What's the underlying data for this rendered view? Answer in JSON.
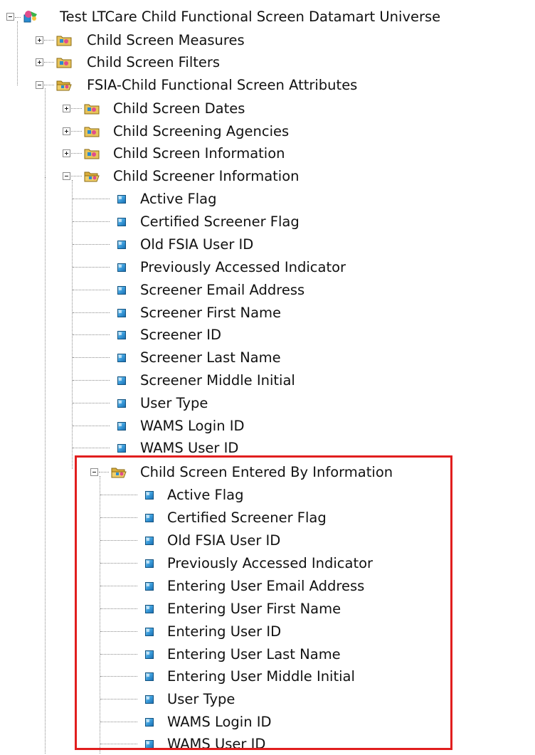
{
  "colors": {
    "highlight": "#e11e1e",
    "field_icon": "#2a8bd0",
    "folder": "#e7c35a"
  },
  "root": {
    "label": "Test LTCare Child Functional Screen Datamart Universe",
    "icon": "universe-icon",
    "expanded": true
  },
  "level1": [
    {
      "label": "Child Screen Measures",
      "icon": "class-folder-icon",
      "expanded": false
    },
    {
      "label": "Child Screen Filters",
      "icon": "class-folder-icon",
      "expanded": false
    },
    {
      "label": "FSIA-Child Functional Screen Attributes",
      "icon": "class-folder-open-icon",
      "expanded": true
    }
  ],
  "level2": [
    {
      "label": "Child Screen Dates",
      "expanded": false
    },
    {
      "label": "Child Screening Agencies",
      "expanded": false
    },
    {
      "label": "Child Screen Information",
      "expanded": false
    },
    {
      "label": "Child Screener Information",
      "expanded": true
    }
  ],
  "screener_fields": [
    "Active Flag",
    "Certified Screener Flag",
    "Old FSIA User ID",
    "Previously Accessed Indicator",
    "Screener Email Address",
    "Screener First Name",
    "Screener ID",
    "Screener Last Name",
    "Screener Middle Initial",
    "User Type",
    "WAMS Login ID",
    "WAMS User ID"
  ],
  "entered_by": {
    "label": "Child Screen Entered By Information",
    "expanded": true,
    "highlighted": true,
    "fields": [
      "Active Flag",
      "Certified Screener Flag",
      "Old FSIA User ID",
      "Previously Accessed Indicator",
      "Entering User Email Address",
      "Entering User First Name",
      "Entering User ID",
      "Entering User Last Name",
      "Entering User Middle Initial",
      "User Type",
      "WAMS Login ID",
      "WAMS User ID"
    ]
  }
}
